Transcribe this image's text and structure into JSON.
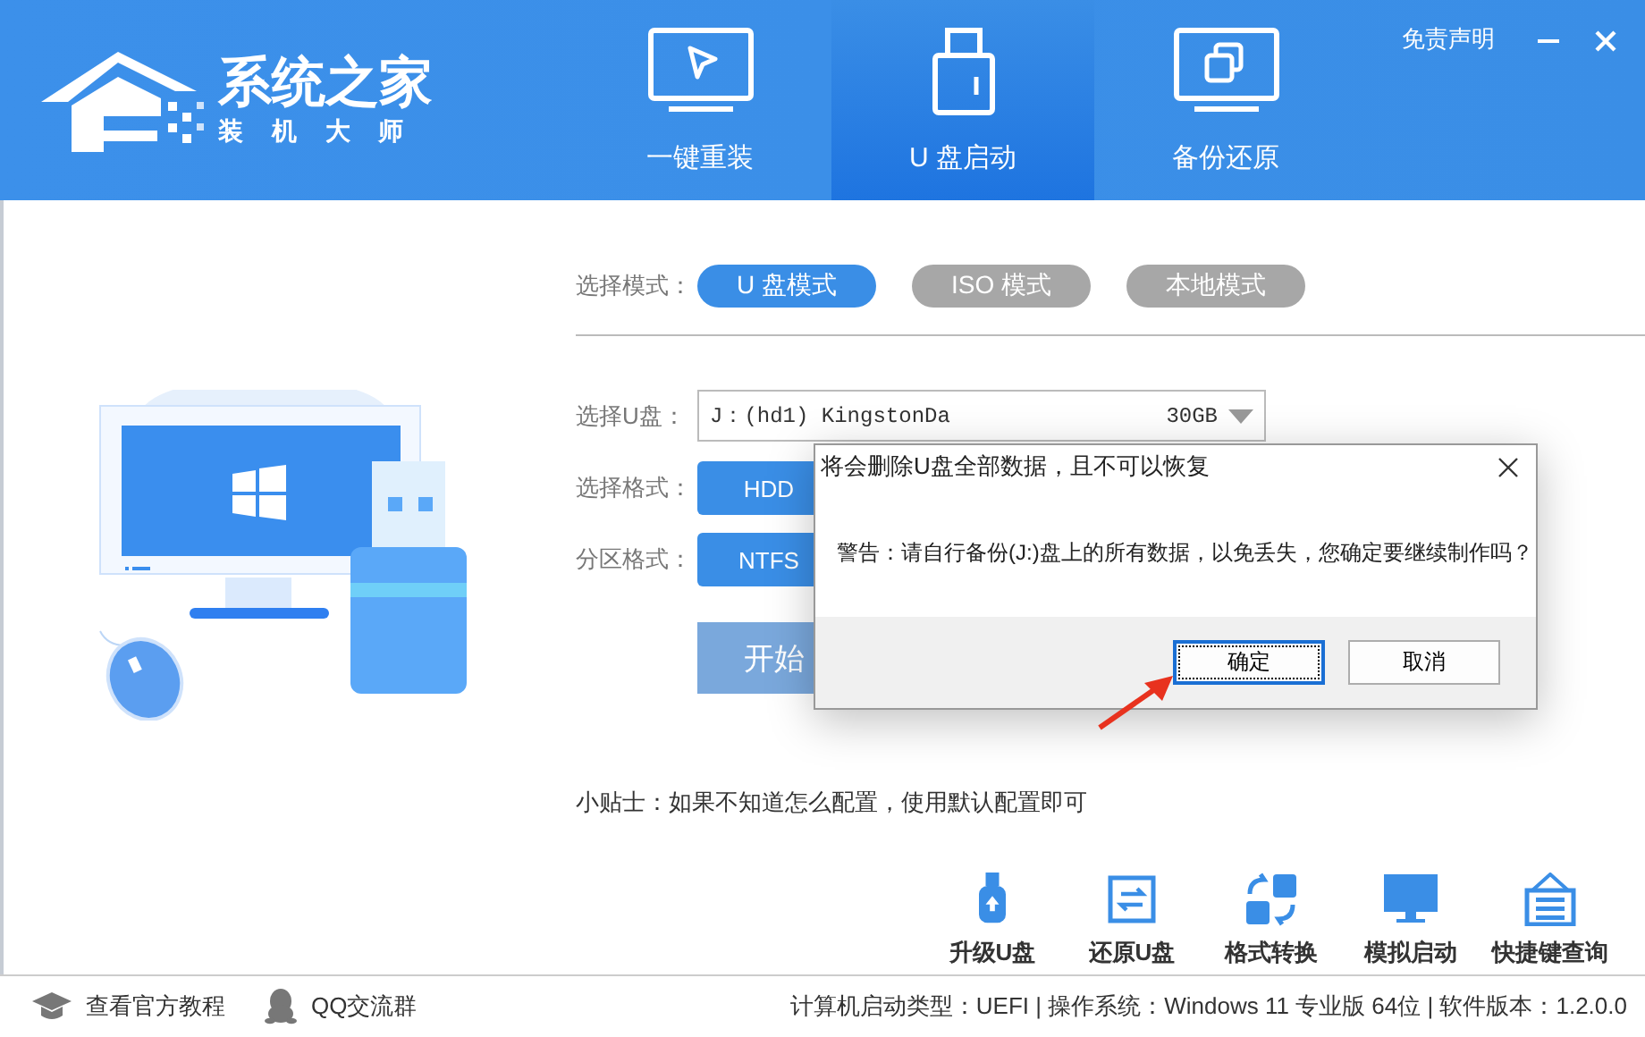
{
  "header": {
    "logo": {
      "title": "系统之家",
      "subtitle": "装 机 大 师"
    },
    "nav_tabs": [
      {
        "label": "一键重装",
        "kind": "install",
        "selected": false
      },
      {
        "label": "U 盘启动",
        "kind": "usb",
        "selected": true
      },
      {
        "label": "备份还原",
        "kind": "backup",
        "selected": false
      }
    ],
    "disclaimer_link": "免责声明"
  },
  "mode": {
    "label": "选择模式：",
    "options": [
      {
        "label": "U 盘模式",
        "selected": true
      },
      {
        "label": "ISO 模式",
        "selected": false
      },
      {
        "label": "本地模式",
        "selected": false
      }
    ]
  },
  "drive": {
    "label": "选择U盘：",
    "value_start": "J：(hd1) KingstonDa",
    "value_end": "30GB"
  },
  "format": {
    "label": "选择格式：",
    "value": "HDD"
  },
  "partition": {
    "label": "分区格式：",
    "value": "NTFS"
  },
  "start_button": "开始",
  "tip": "小贴士：如果不知道怎么配置，使用默认配置即可",
  "tools": [
    {
      "label": "升级U盘",
      "kind": "upgrade"
    },
    {
      "label": "还原U盘",
      "kind": "restore"
    },
    {
      "label": "格式转换",
      "kind": "convert"
    },
    {
      "label": "模拟启动",
      "kind": "simulate"
    },
    {
      "label": "快捷键查询",
      "kind": "hotkey"
    }
  ],
  "status_bar": {
    "links": [
      {
        "label": "查看官方教程",
        "kind": "tutorial"
      },
      {
        "label": "QQ交流群",
        "kind": "qq"
      }
    ],
    "info": "计算机启动类型：UEFI | 操作系统：Windows 11 专业版 64位 | 软件版本：1.2.0.0"
  },
  "dialog": {
    "title": "将会删除U盘全部数据，且不可以恢复",
    "message": "警告：请自行备份(J:)盘上的所有数据，以免丢失，您确定要继续制作吗？",
    "buttons": [
      {
        "label": "确定",
        "selected": true
      },
      {
        "label": "取消",
        "selected": false
      }
    ]
  }
}
